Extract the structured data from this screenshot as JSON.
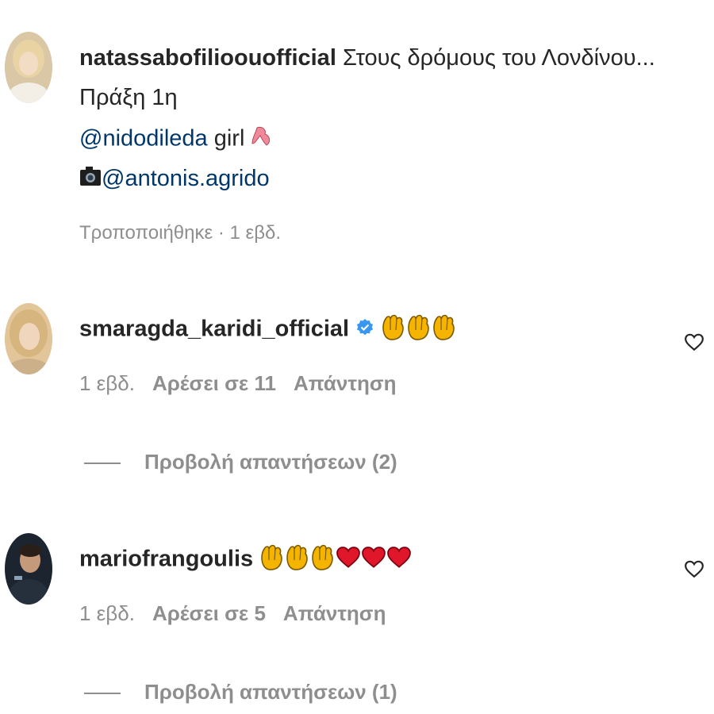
{
  "post": {
    "username": "natassabofilioouofficial",
    "caption_line1": "Στους δρόμους του Λονδίνου...",
    "caption_line2": "Πράξη 1η",
    "mention1": "@nidodileda",
    "mention1_suffix": " girl",
    "mention2": "@antonis.agrido",
    "edited_meta": "Τροποποιήθηκε · 1 εβδ."
  },
  "comments": [
    {
      "username": "smaragda_karidi_official",
      "verified": true,
      "emojis": [
        "clap-emoji",
        "clap-emoji",
        "clap-emoji"
      ],
      "time": "1 εβδ.",
      "likes": "Αρέσει σε 11",
      "reply": "Απάντηση",
      "view_replies": "Προβολή απαντήσεων (2)"
    },
    {
      "username": "mariofrangoulis",
      "verified": false,
      "emojis": [
        "clap-emoji",
        "clap-emoji",
        "clap-emoji",
        "red-heart-emoji",
        "red-heart-emoji",
        "red-heart-emoji"
      ],
      "time": "1 εβδ.",
      "likes": "Αρέσει σε 5",
      "reply": "Απάντηση",
      "view_replies": "Προβολή απαντήσεων (1)"
    }
  ],
  "colors": {
    "link": "#00376b",
    "meta": "#8e8e8e",
    "verified": "#3897f0",
    "heart_emoji": "#e0162b",
    "clap_emoji": "#f4b400"
  }
}
